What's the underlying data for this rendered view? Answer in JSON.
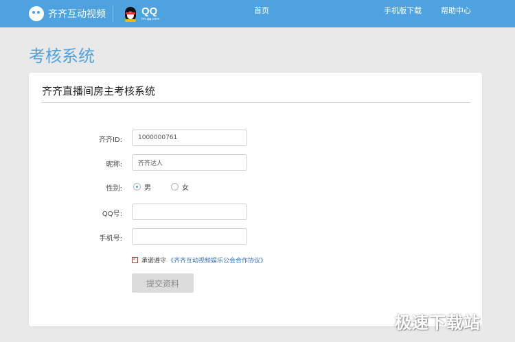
{
  "header": {
    "brand_name": "齐齐互动视频",
    "qq_title": "QQ",
    "qq_subtitle": "im.qq.com",
    "nav": {
      "home": "首页",
      "mobile_download": "手机版下载",
      "help_center": "帮助中心"
    },
    "bg_color": "#4ea2e0"
  },
  "page": {
    "title": "考核系统"
  },
  "form": {
    "card_title": "齐齐直播间房主考核系统",
    "qiqi_id": {
      "label": "齐齐ID:",
      "value": "1000000761"
    },
    "nickname": {
      "label": "昵称:",
      "value": "齐齐达人"
    },
    "gender": {
      "label": "性别:",
      "options": [
        "男",
        "女"
      ],
      "selected": "男"
    },
    "qq_number": {
      "label": "QQ号:",
      "value": ""
    },
    "phone": {
      "label": "手机号:",
      "value": ""
    },
    "agreement": {
      "checked": true,
      "text": "承诺遵守",
      "link_text": "《齐齐互动视频娱乐公会合作协议》"
    },
    "submit_label": "提交资料"
  },
  "watermark": "极速下载站",
  "colors": {
    "accent": "#4ea2e0",
    "link": "#3a6fb5",
    "checkbox": "#c0392b"
  }
}
